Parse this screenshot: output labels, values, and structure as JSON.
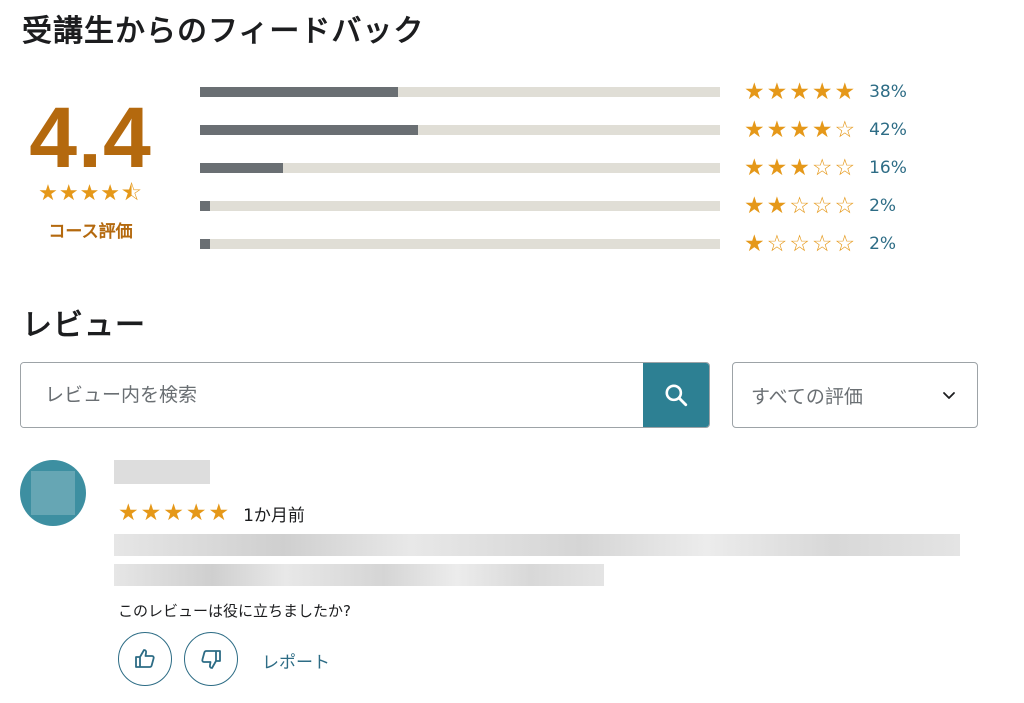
{
  "feedback": {
    "title": "受講生からのフィードバック",
    "average": "4.4",
    "average_stars": "★★★★⯪",
    "label": "コース評価",
    "rows": [
      {
        "stars": "★★★★★",
        "percent": "38%",
        "share": 0.38
      },
      {
        "stars": "★★★★☆",
        "percent": "42%",
        "share": 0.42
      },
      {
        "stars": "★★★☆☆",
        "percent": "16%",
        "share": 0.16
      },
      {
        "stars": "★★☆☆☆",
        "percent": "2%",
        "share": 0.02
      },
      {
        "stars": "★☆☆☆☆",
        "percent": "2%",
        "share": 0.02
      }
    ]
  },
  "reviews": {
    "title": "レビュー",
    "search": {
      "placeholder": "レビュー内を検索",
      "icon": "search-icon"
    },
    "filter": {
      "value": "すべての評価",
      "icon": "chevron-down-icon"
    },
    "items": [
      {
        "stars": "★★★★★",
        "date": "1か月前",
        "helpful_question": "このレビューは役に立ちましたか?",
        "report_label": "レポート"
      }
    ]
  },
  "colors": {
    "rating_accent": "#b4690e",
    "star": "#e59819",
    "bar_fill": "#6a6f73",
    "bar_track": "#e0ded6",
    "link": "#2d6c85",
    "search_button": "#2d8093",
    "avatar": "#3d8fa1"
  }
}
